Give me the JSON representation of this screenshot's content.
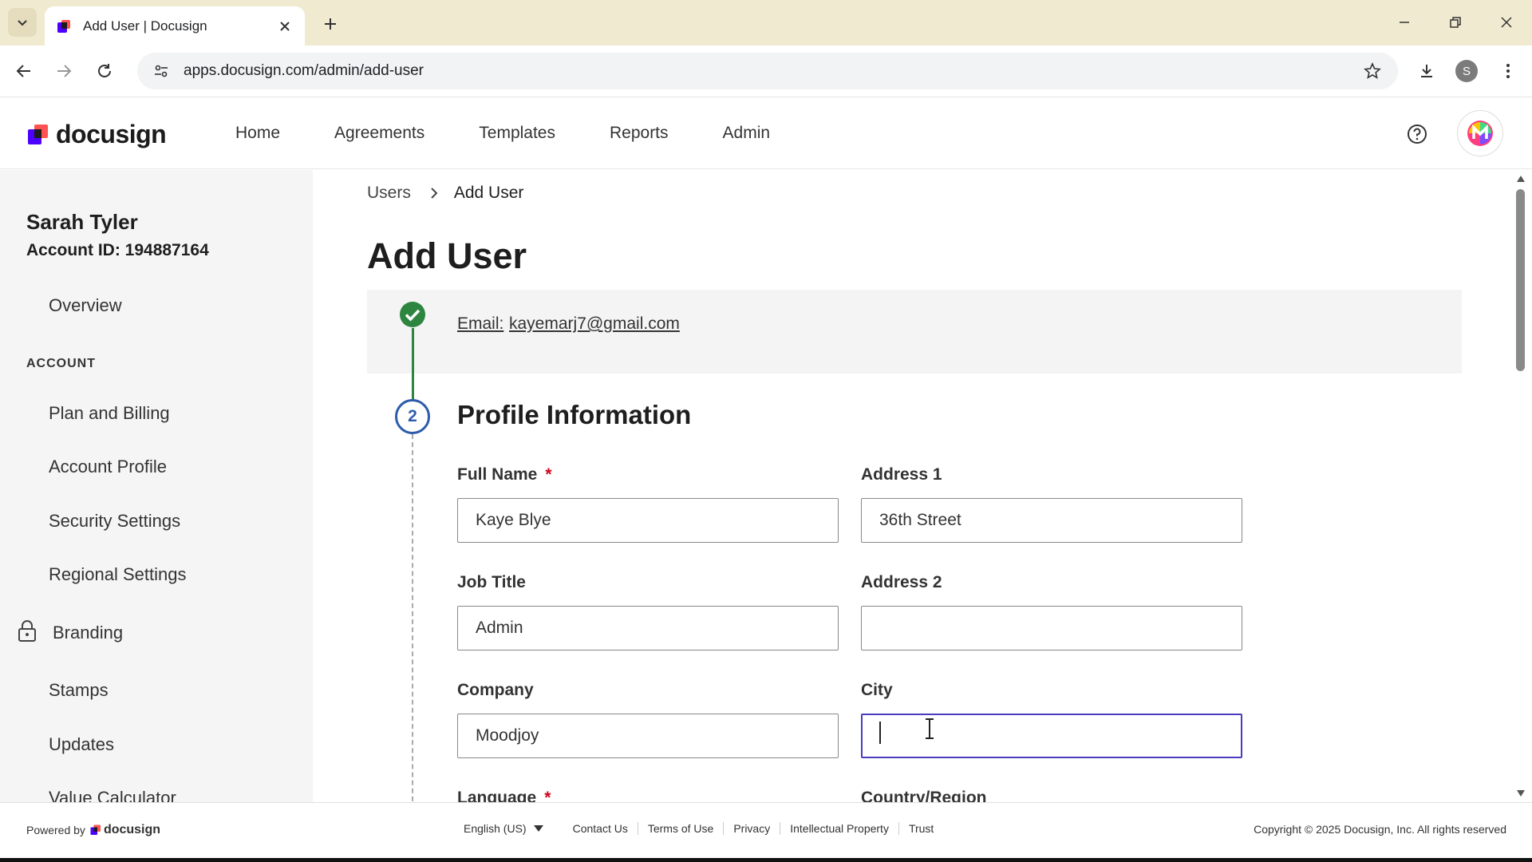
{
  "browser": {
    "tab_title": "Add User | Docusign",
    "url": "apps.docusign.com/admin/add-user",
    "profile_initial": "S"
  },
  "header": {
    "logo_text": "docusign",
    "nav": [
      "Home",
      "Agreements",
      "Templates",
      "Reports",
      "Admin"
    ]
  },
  "sidebar": {
    "user_name": "Sarah Tyler",
    "account_id": "Account ID: 194887164",
    "overview": "Overview",
    "section_account": "ACCOUNT",
    "items": [
      "Plan and Billing",
      "Account Profile",
      "Security Settings",
      "Regional Settings",
      "Branding",
      "Stamps",
      "Updates",
      "Value Calculator"
    ]
  },
  "main": {
    "breadcrumb": {
      "parent": "Users",
      "current": "Add User"
    },
    "title": "Add User",
    "step1": {
      "label": "Email:",
      "value": "kayemarj7@gmail.com"
    },
    "step2": {
      "number": "2",
      "title": "Profile Information"
    },
    "fields": {
      "full_name": {
        "label": "Full Name",
        "required": "*",
        "value": "Kaye Blye"
      },
      "address1": {
        "label": "Address 1",
        "value": "36th Street"
      },
      "job_title": {
        "label": "Job Title",
        "value": "Admin"
      },
      "address2": {
        "label": "Address 2",
        "value": ""
      },
      "company": {
        "label": "Company",
        "value": "Moodjoy"
      },
      "city": {
        "label": "City",
        "value": ""
      },
      "language": {
        "label": "Language",
        "required": "*"
      },
      "country": {
        "label": "Country/Region"
      }
    }
  },
  "footer": {
    "powered_by": "Powered by",
    "logo_text": "docusign",
    "language": "English (US)",
    "links": [
      "Contact Us",
      "Terms of Use",
      "Privacy",
      "Intellectual Property",
      "Trust"
    ],
    "copyright": "Copyright © 2025 Docusign, Inc. All rights reserved"
  },
  "colors": {
    "brand_purple": "#4c00ff",
    "step_complete": "#2e8540",
    "step_active": "#2c5cab",
    "focus_border": "#4a3dbd",
    "required": "#d0021b"
  }
}
